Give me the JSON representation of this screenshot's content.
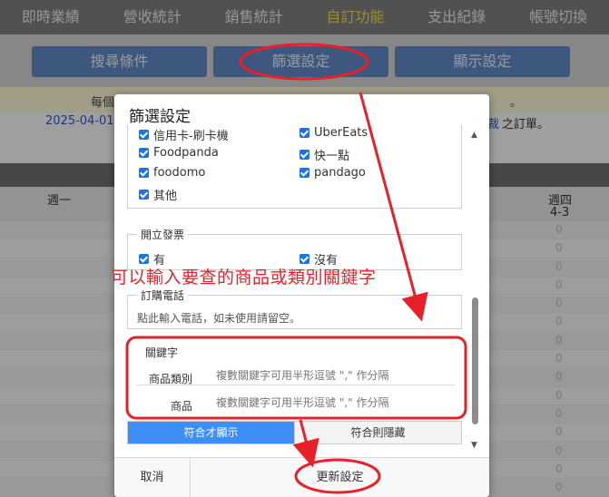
{
  "nav": {
    "items": [
      "即時業績",
      "營收統計",
      "銷售統計",
      "自訂功能",
      "支出紀錄",
      "帳號切換"
    ],
    "active_index": 3,
    "active_color": "#f2d64b"
  },
  "toolbar": {
    "buttons": [
      "搜尋條件",
      "篩選設定",
      "顯示設定"
    ]
  },
  "notice": {
    "left_text": "每個",
    "right_text": "。"
  },
  "date_row": {
    "date_text": "2025-04-01",
    "link_tail": "裁",
    "tail_text": "之訂單。"
  },
  "week_header": {
    "first_day": "週一",
    "fourth_day": "週四",
    "fourth_date": "4-3"
  },
  "table": {
    "zeros": [
      "0",
      "0",
      "0",
      "0",
      "0",
      "0",
      "0",
      "0",
      "0",
      "0",
      "0",
      "0",
      "0",
      "0",
      "0"
    ]
  },
  "modal": {
    "title": "篩選設定",
    "payments": {
      "items": [
        "信用卡-刷卡機",
        "UberEats",
        "Foodpanda",
        "快一點",
        "foodomo",
        "pandago",
        "其他"
      ]
    },
    "invoice": {
      "legend": "開立發票",
      "options": [
        "有",
        "沒有"
      ]
    },
    "phone": {
      "legend": "訂購電話",
      "placeholder": "點此輸入電話，如未使用請留空。"
    },
    "keyword": {
      "legend": "關鍵字",
      "category_label": "商品類別",
      "category_placeholder": "複數關鍵字可用半形逗號 \",\" 作分隔",
      "product_label": "商品",
      "product_placeholder": "複數關鍵字可用半形逗號 \",\" 作分隔"
    },
    "mode": {
      "show_label": "符合才顯示",
      "hide_label": "符合則隱藏"
    },
    "footer": {
      "cancel_label": "取消",
      "update_label": "更新設定"
    }
  },
  "annotation": {
    "text": "可以輸入要查的商品或類別關鍵字",
    "color": "#e8202a"
  },
  "colors": {
    "toolbar_button": "#5e86c2",
    "segment_active": "#3d8ff5",
    "checkbox": "#1a73e8"
  }
}
